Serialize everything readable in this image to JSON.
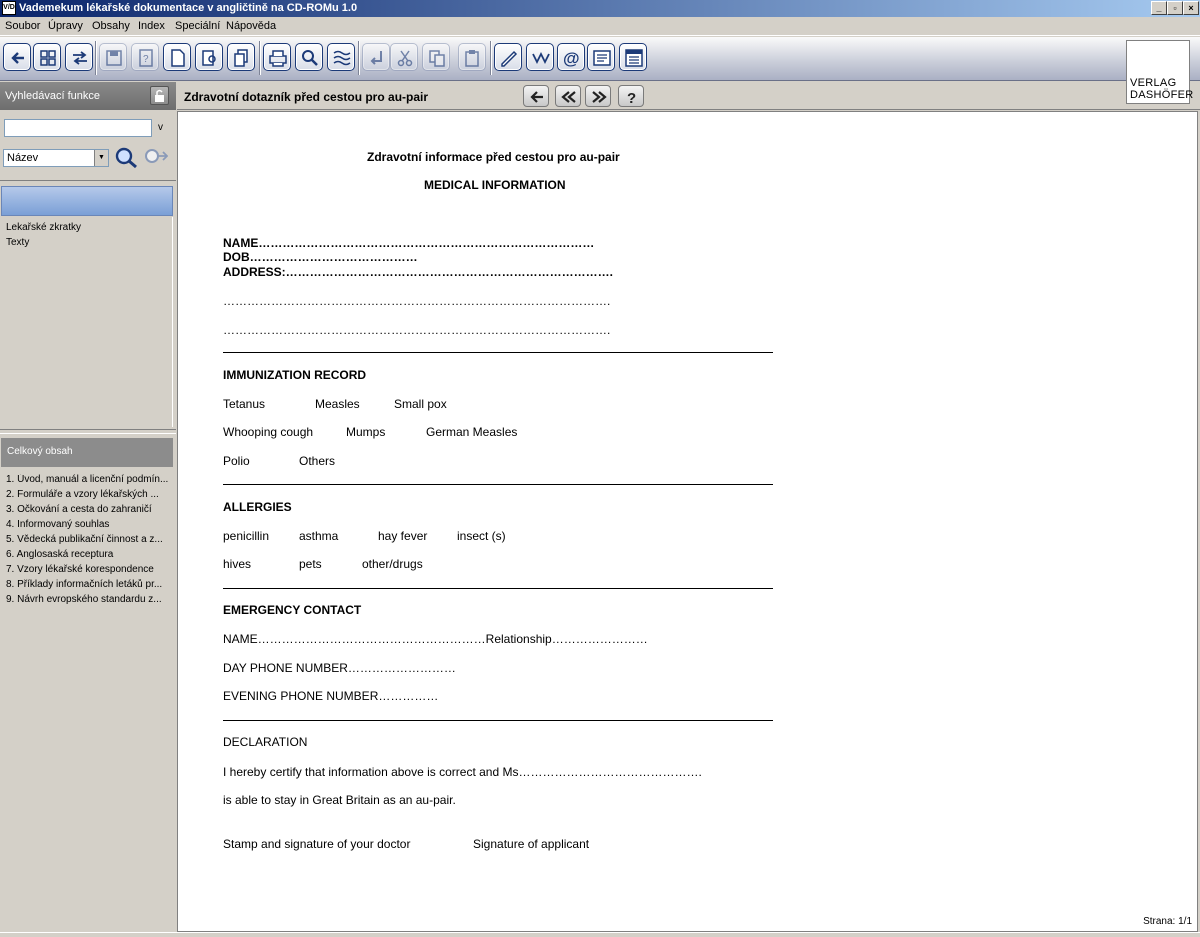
{
  "window": {
    "title": "Vademekum lékařské dokumentace v angličtině na CD-ROMu 1.0",
    "icon_text": "V/D"
  },
  "menu": [
    "Soubor",
    "Úpravy",
    "Obsahy",
    "Index",
    "Speciální",
    "Nápověda"
  ],
  "toolbar_icons": [
    "back-icon",
    "contents-icon",
    "link-icon",
    "save-icon",
    "help-page-icon",
    "page-icon",
    "find-page-icon",
    "copy-page-icon",
    "print-icon",
    "search-icon",
    "text-wave-icon",
    "insert-icon",
    "cut-icon",
    "copy-icon",
    "paste-icon",
    "edit-icon",
    "web-icon",
    "email-icon",
    "news-icon",
    "portal-icon"
  ],
  "logo": {
    "line1": "VERLAG",
    "line2": "DASHÖFER"
  },
  "left": {
    "search_header": "Vyhledávací funkce",
    "search_value": "",
    "search_toggle": "v",
    "field_select": "Název",
    "list_top": [
      "Lekařské zkratky",
      "Texty"
    ],
    "contents_header": "Celkový obsah",
    "contents": [
      "1. Úvod, manuál a licenční podmín...",
      "2. Formuláře a vzory lékařských ...",
      "3. Očkování a cesta do zahraničí",
      "4. Informovaný souhlas",
      "5. Vědecká publikační činnost a z...",
      "6. Anglosaská receptura",
      "7. Vzory lékařské korespondence",
      "8. Příklady informačních letáků pr...",
      "9. Návrh evropského standardu z..."
    ]
  },
  "doc_header": {
    "title": "Zdravotní dotazník před cestou pro au-pair",
    "help": "?"
  },
  "doc": {
    "title_cz": "Zdravotní informace před cestou pro au-pair",
    "title_en": "MEDICAL INFORMATION",
    "name": "NAME…………………………………………………………………………",
    "dob": "DOB……………………………………",
    "address": "ADDRESS:……………………………………………………………………….",
    "addr2": "…………………………………………………………………………………….",
    "addr3": "…………………………………………………………………………………….",
    "immun_h": "IMMUNIZATION RECORD",
    "immun": [
      "Tetanus",
      "Measles",
      "Small pox",
      "Whooping cough",
      "Mumps",
      "German Measles",
      "Polio",
      "Others"
    ],
    "allerg_h": "ALLERGIES",
    "allerg": [
      "penicillin",
      "asthma",
      "hay fever",
      "insect (s)",
      "hives",
      "pets",
      "other/drugs"
    ],
    "emerg_h": "EMERGENCY CONTACT",
    "emerg_name": "NAME…………………………………………………Relationship……………………",
    "day_phone": "DAY PHONE NUMBER………………………",
    "eve_phone": "EVENING PHONE NUMBER……………",
    "decl_h": "DECLARATION",
    "decl1": "I hereby certify that information above is correct and Ms……………………………………….",
    "decl2": "is able to stay in Great Britain as an au-pair.",
    "sig1": "Stamp and signature of your doctor",
    "sig2": "Signature of applicant"
  },
  "status": {
    "page": "Strana: 1/1"
  }
}
